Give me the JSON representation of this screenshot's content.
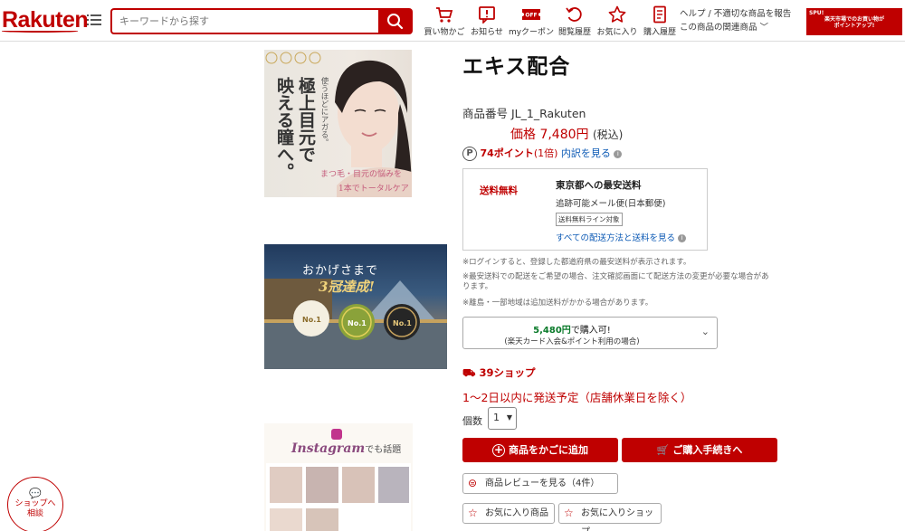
{
  "header": {
    "logo": "Rakuten",
    "search_placeholder": "キーワードから探す",
    "nav": [
      {
        "label": "買い物かご",
        "icon": "cart-icon"
      },
      {
        "label": "お知らせ",
        "icon": "notice-icon"
      },
      {
        "label": "myクーポン",
        "icon": "coupon-icon",
        "badge": "OFF"
      },
      {
        "label": "閲覧履歴",
        "icon": "history-icon"
      },
      {
        "label": "お気に入り",
        "icon": "star-icon"
      },
      {
        "label": "購入履歴",
        "icon": "receipt-icon"
      }
    ],
    "help_line1": "ヘルプ / 不適切な商品を報告",
    "help_line2": "この商品の関連商品 ﹀",
    "spu_line1": "SPU!",
    "spu_line2": "楽天市場でのお買い物が",
    "spu_line3": "ポイントアップ!"
  },
  "images": {
    "img1_heading": "映える瞳へ。",
    "img1_heading2": "極上目元で",
    "img1_sub": "使うほどにアガる。",
    "img1_caption1": "まつ毛・目元の悩みを",
    "img1_caption2": "1本でトータルケア",
    "img2_text1": "おかげさまで",
    "img2_text2": "3冠達成!",
    "img2_badge": "No.1",
    "img3_brand": "Instagram",
    "img3_text": "でも話題"
  },
  "product": {
    "title": "エキス配合",
    "item_no": "商品番号  JL_1_Rakuten",
    "price_label": "価格",
    "price": "7,480円",
    "tax": "(税込)",
    "point_icon": "P",
    "points": "74ポイント",
    "points_mult": "(1倍)",
    "points_link": "内訳を見る",
    "ship_free": "送料無料",
    "ship_title": "東京都への最安送料",
    "ship_method": "追跡可能メール便(日本郵便)",
    "ship_tag": "送料無料ライン対象",
    "ship_link": "すべての配送方法と送料を見る",
    "note1": "※ログインすると、登録した都道府県の最安送料が表示されます。",
    "note2a": "※最安送料での配送をご希望の場合、注文確認画面にて配送方法の変更が必要な場合があ",
    "note2b": "ります。",
    "note3": "※離島・一部地域は追加送料がかかる場合があります。",
    "card_amount": "5,480円",
    "card_amount_suffix": "で購入可!",
    "card_sub": "(楽天カード入会&ポイント利用の場合)",
    "shop39": "39ショップ",
    "ship_date": "1〜2日以内に発送予定（店舗休業日を除く）",
    "qty_label": "個数",
    "qty_value": "1",
    "add_cart": "商品をかごに追加",
    "checkout": "ご購入手続きへ",
    "reviews": "商品レビューを見る（4件）",
    "fav_item": "お気に入り商品",
    "fav_shop": "お気に入りショップ",
    "chat_line1": "ショップへ",
    "chat_line2": "相談"
  },
  "colors": {
    "brand": "#bf0000",
    "link": "#0c5ab5",
    "green": "#0a7a2a"
  }
}
